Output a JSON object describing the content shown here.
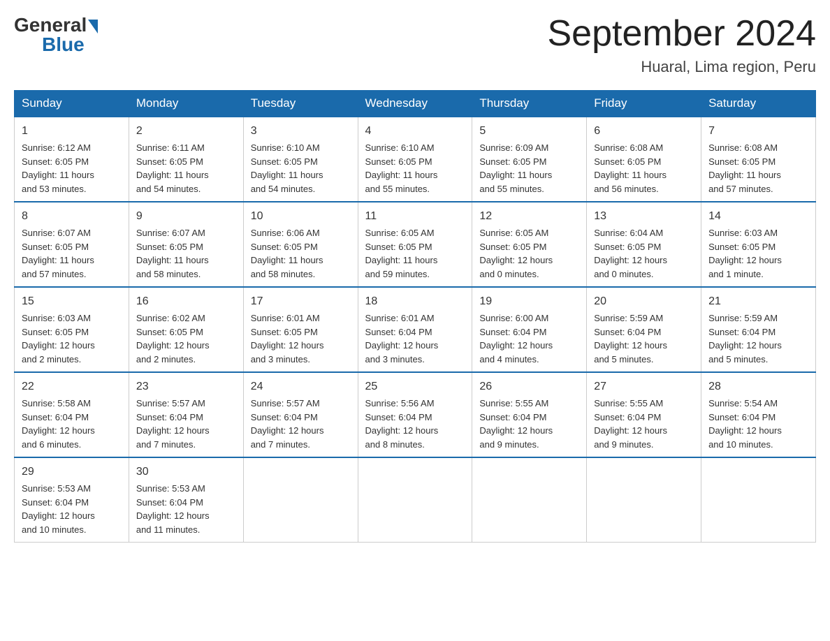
{
  "header": {
    "logo_general": "General",
    "logo_blue": "Blue",
    "title": "September 2024",
    "subtitle": "Huaral, Lima region, Peru"
  },
  "weekdays": [
    "Sunday",
    "Monday",
    "Tuesday",
    "Wednesday",
    "Thursday",
    "Friday",
    "Saturday"
  ],
  "weeks": [
    [
      {
        "day": "1",
        "info": "Sunrise: 6:12 AM\nSunset: 6:05 PM\nDaylight: 11 hours\nand 53 minutes."
      },
      {
        "day": "2",
        "info": "Sunrise: 6:11 AM\nSunset: 6:05 PM\nDaylight: 11 hours\nand 54 minutes."
      },
      {
        "day": "3",
        "info": "Sunrise: 6:10 AM\nSunset: 6:05 PM\nDaylight: 11 hours\nand 54 minutes."
      },
      {
        "day": "4",
        "info": "Sunrise: 6:10 AM\nSunset: 6:05 PM\nDaylight: 11 hours\nand 55 minutes."
      },
      {
        "day": "5",
        "info": "Sunrise: 6:09 AM\nSunset: 6:05 PM\nDaylight: 11 hours\nand 55 minutes."
      },
      {
        "day": "6",
        "info": "Sunrise: 6:08 AM\nSunset: 6:05 PM\nDaylight: 11 hours\nand 56 minutes."
      },
      {
        "day": "7",
        "info": "Sunrise: 6:08 AM\nSunset: 6:05 PM\nDaylight: 11 hours\nand 57 minutes."
      }
    ],
    [
      {
        "day": "8",
        "info": "Sunrise: 6:07 AM\nSunset: 6:05 PM\nDaylight: 11 hours\nand 57 minutes."
      },
      {
        "day": "9",
        "info": "Sunrise: 6:07 AM\nSunset: 6:05 PM\nDaylight: 11 hours\nand 58 minutes."
      },
      {
        "day": "10",
        "info": "Sunrise: 6:06 AM\nSunset: 6:05 PM\nDaylight: 11 hours\nand 58 minutes."
      },
      {
        "day": "11",
        "info": "Sunrise: 6:05 AM\nSunset: 6:05 PM\nDaylight: 11 hours\nand 59 minutes."
      },
      {
        "day": "12",
        "info": "Sunrise: 6:05 AM\nSunset: 6:05 PM\nDaylight: 12 hours\nand 0 minutes."
      },
      {
        "day": "13",
        "info": "Sunrise: 6:04 AM\nSunset: 6:05 PM\nDaylight: 12 hours\nand 0 minutes."
      },
      {
        "day": "14",
        "info": "Sunrise: 6:03 AM\nSunset: 6:05 PM\nDaylight: 12 hours\nand 1 minute."
      }
    ],
    [
      {
        "day": "15",
        "info": "Sunrise: 6:03 AM\nSunset: 6:05 PM\nDaylight: 12 hours\nand 2 minutes."
      },
      {
        "day": "16",
        "info": "Sunrise: 6:02 AM\nSunset: 6:05 PM\nDaylight: 12 hours\nand 2 minutes."
      },
      {
        "day": "17",
        "info": "Sunrise: 6:01 AM\nSunset: 6:05 PM\nDaylight: 12 hours\nand 3 minutes."
      },
      {
        "day": "18",
        "info": "Sunrise: 6:01 AM\nSunset: 6:04 PM\nDaylight: 12 hours\nand 3 minutes."
      },
      {
        "day": "19",
        "info": "Sunrise: 6:00 AM\nSunset: 6:04 PM\nDaylight: 12 hours\nand 4 minutes."
      },
      {
        "day": "20",
        "info": "Sunrise: 5:59 AM\nSunset: 6:04 PM\nDaylight: 12 hours\nand 5 minutes."
      },
      {
        "day": "21",
        "info": "Sunrise: 5:59 AM\nSunset: 6:04 PM\nDaylight: 12 hours\nand 5 minutes."
      }
    ],
    [
      {
        "day": "22",
        "info": "Sunrise: 5:58 AM\nSunset: 6:04 PM\nDaylight: 12 hours\nand 6 minutes."
      },
      {
        "day": "23",
        "info": "Sunrise: 5:57 AM\nSunset: 6:04 PM\nDaylight: 12 hours\nand 7 minutes."
      },
      {
        "day": "24",
        "info": "Sunrise: 5:57 AM\nSunset: 6:04 PM\nDaylight: 12 hours\nand 7 minutes."
      },
      {
        "day": "25",
        "info": "Sunrise: 5:56 AM\nSunset: 6:04 PM\nDaylight: 12 hours\nand 8 minutes."
      },
      {
        "day": "26",
        "info": "Sunrise: 5:55 AM\nSunset: 6:04 PM\nDaylight: 12 hours\nand 9 minutes."
      },
      {
        "day": "27",
        "info": "Sunrise: 5:55 AM\nSunset: 6:04 PM\nDaylight: 12 hours\nand 9 minutes."
      },
      {
        "day": "28",
        "info": "Sunrise: 5:54 AM\nSunset: 6:04 PM\nDaylight: 12 hours\nand 10 minutes."
      }
    ],
    [
      {
        "day": "29",
        "info": "Sunrise: 5:53 AM\nSunset: 6:04 PM\nDaylight: 12 hours\nand 10 minutes."
      },
      {
        "day": "30",
        "info": "Sunrise: 5:53 AM\nSunset: 6:04 PM\nDaylight: 12 hours\nand 11 minutes."
      },
      {
        "day": "",
        "info": ""
      },
      {
        "day": "",
        "info": ""
      },
      {
        "day": "",
        "info": ""
      },
      {
        "day": "",
        "info": ""
      },
      {
        "day": "",
        "info": ""
      }
    ]
  ]
}
